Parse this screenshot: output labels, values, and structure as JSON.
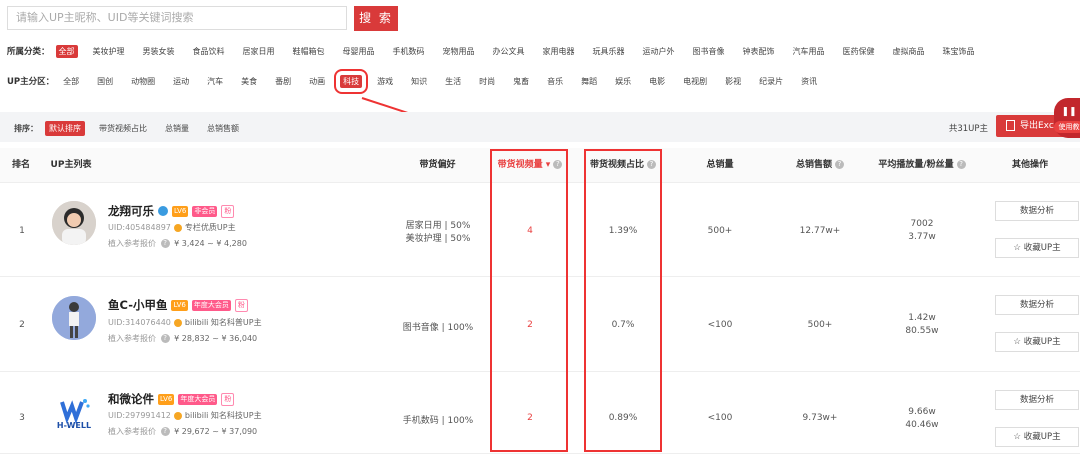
{
  "search": {
    "placeholder": "请输入UP主昵称、UID等关键词搜索",
    "button": "搜 索"
  },
  "category": {
    "label": "所属分类：",
    "options": [
      "全部",
      "美妆护理",
      "男装女装",
      "食品饮料",
      "居家日用",
      "鞋帽箱包",
      "母婴用品",
      "手机数码",
      "宠物用品",
      "办公文具",
      "家用电器",
      "玩具乐器",
      "运动户外",
      "图书音像",
      "钟表配饰",
      "汽车用品",
      "医药保健",
      "虚拟商品",
      "珠宝饰品"
    ],
    "active": "全部"
  },
  "zone": {
    "label": "UP主分区：",
    "options": [
      "全部",
      "国创",
      "动物圈",
      "运动",
      "汽车",
      "美食",
      "番剧",
      "动画",
      "科技",
      "游戏",
      "知识",
      "生活",
      "时尚",
      "鬼畜",
      "音乐",
      "舞蹈",
      "娱乐",
      "电影",
      "电视剧",
      "影视",
      "纪录片",
      "资讯"
    ],
    "active": "科技"
  },
  "sort": {
    "label": "排序：",
    "options": [
      "默认排序",
      "带货视频占比",
      "总销量",
      "总销售额"
    ],
    "active": "默认排序"
  },
  "total": "共31UP主",
  "export": "导出Excel",
  "help": "使用教",
  "headers": {
    "rank": "排名",
    "list": "UP主列表",
    "pref": "带货偏好",
    "videos": "带货视频量",
    "ratio": "带货视频占比",
    "sales": "总销量",
    "revenue": "总销售额",
    "play": "平均播放量/粉丝量",
    "ops": "其他操作"
  },
  "rows": [
    {
      "rank": "1",
      "name": "龙翔可乐",
      "lv": "LV6",
      "member": "非会员",
      "fan": "粉",
      "uid": "UID:405484897",
      "desc": "专栏优质UP主",
      "price_label": "植入参考报价",
      "price": "¥ 3,424 ~ ¥ 4,280",
      "pref1": "居家日用 | 50%",
      "pref2": "美妆护理 | 50%",
      "videos": "4",
      "ratio": "1.39%",
      "sales": "500+",
      "revenue": "12.77w+",
      "play": "7002",
      "fans": "3.77w",
      "btn1": "数据分析",
      "btn2": "☆ 收藏UP主"
    },
    {
      "rank": "2",
      "name": "鱼C-小甲鱼",
      "lv": "LV6",
      "member": "年度大会员",
      "fan": "粉",
      "uid": "UID:314076440",
      "desc": "bilibili 知名科普UP主",
      "price_label": "植入参考报价",
      "price": "¥ 28,832 ~ ¥ 36,040",
      "pref1": "图书音像 | 100%",
      "pref2": "",
      "videos": "2",
      "ratio": "0.7%",
      "sales": "<100",
      "revenue": "500+",
      "play": "1.42w",
      "fans": "80.55w",
      "btn1": "数据分析",
      "btn2": "☆ 收藏UP主"
    },
    {
      "rank": "3",
      "name": "和微论件",
      "lv": "LV6",
      "member": "年度大会员",
      "fan": "粉",
      "uid": "UID:297991412",
      "desc": "bilibili 知名科技UP主",
      "price_label": "植入参考报价",
      "price": "¥ 29,672 ~ ¥ 37,090",
      "pref1": "手机数码 | 100%",
      "pref2": "",
      "videos": "2",
      "ratio": "0.89%",
      "sales": "<100",
      "revenue": "9.73w+",
      "play": "9.66w",
      "fans": "40.46w",
      "btn1": "数据分析",
      "btn2": "☆ 收藏UP主",
      "logo_text": "H-WELL"
    }
  ],
  "colors": {
    "accent": "#d93a3a",
    "highlight": "#ee3333"
  }
}
